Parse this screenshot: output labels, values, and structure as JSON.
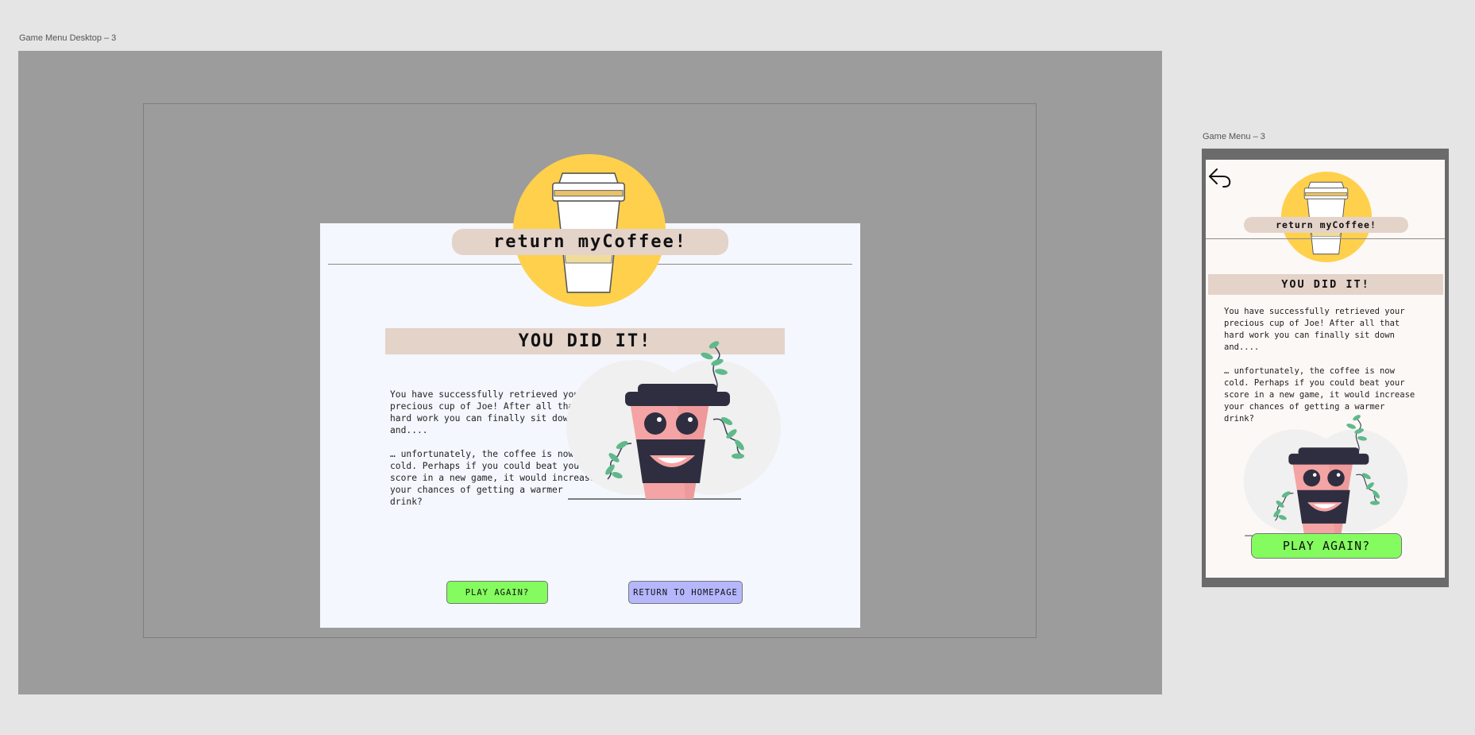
{
  "desktop": {
    "frame_label": "Game Menu Desktop – 3",
    "app_title": "return myCoffee!",
    "heading": "YOU DID IT!",
    "message": "You have successfully retrieved your\nprecious cup of Joe! After all that\nhard work you can finally sit down\nand....\n\n… unfortunately, the coffee is now\ncold. Perhaps if you could beat your\nscore in a new game, it would increase\nyour chances of getting a warmer\ndrink?",
    "play_again_label": "PLAY AGAIN?",
    "homepage_label": "RETURN TO HOMEPAGE"
  },
  "mobile": {
    "frame_label": "Game Menu – 3",
    "app_title": "return myCoffee!",
    "heading": "YOU DID IT!",
    "message": "You have successfully retrieved your\nprecious cup of Joe! After all that\nhard work you can finally sit down\nand....\n\n… unfortunately, the coffee is now\ncold. Perhaps if you could beat your\nscore in a new game, it would increase\nyour chances of getting a warmer\ndrink?",
    "play_again_label": "PLAY AGAIN?"
  },
  "colors": {
    "logo_yellow": "#ffd04c",
    "banner_beige": "#e4d3c9",
    "play_green": "#84fb5f",
    "homepage_lavender": "#b5b6fb",
    "cup_pink": "#f4a4a4",
    "cup_dark": "#2f2e41",
    "leaf_green": "#5fb98a"
  },
  "icons": {
    "back": "back-arrow-icon",
    "logo": "coffee-cup-logo-icon",
    "mascot": "coffee-mascot-illustration"
  }
}
